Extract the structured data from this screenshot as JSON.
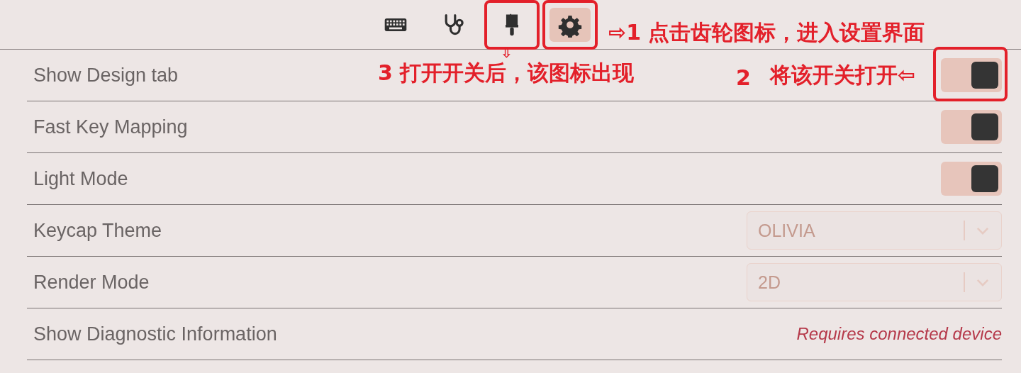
{
  "toolbar": [
    {
      "kind": "keyboard",
      "selected": false,
      "annotated": false
    },
    {
      "kind": "stethoscope",
      "selected": false,
      "annotated": false
    },
    {
      "kind": "brush",
      "selected": false,
      "annotated": true
    },
    {
      "kind": "gear",
      "selected": true,
      "annotated": true
    }
  ],
  "settings": [
    {
      "kind": "toggle",
      "label": "Show Design tab",
      "on": true,
      "annotated": true
    },
    {
      "kind": "toggle",
      "label": "Fast Key Mapping",
      "on": true,
      "annotated": false
    },
    {
      "kind": "toggle",
      "label": "Light Mode",
      "on": true,
      "annotated": false
    },
    {
      "kind": "select",
      "label": "Keycap Theme",
      "value": "OLIVIA",
      "disabled": true
    },
    {
      "kind": "select",
      "label": "Render Mode",
      "value": "2D",
      "disabled": true
    },
    {
      "kind": "note",
      "label": "Show Diagnostic Information",
      "note": "Requires connected device"
    }
  ],
  "annotations": [
    {
      "text": "⇨1 点击齿轮图标，进入设置界面"
    },
    {
      "text": "⇩"
    },
    {
      "text": "3 打开开关后，该图标出现"
    },
    {
      "text": "2"
    },
    {
      "text": "将该开关打开⇦"
    }
  ]
}
